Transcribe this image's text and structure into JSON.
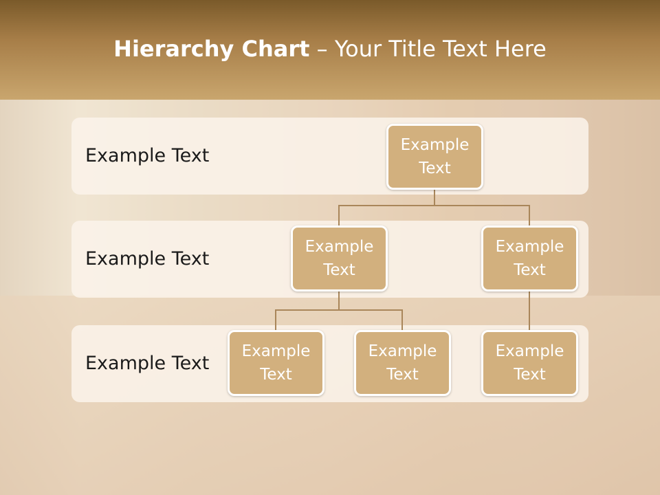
{
  "title": {
    "bold": "Hierarchy Chart",
    "rest": " – Your Title Text Here"
  },
  "levels": [
    {
      "label": "Example Text"
    },
    {
      "label": "Example Text"
    },
    {
      "label": "Example Text"
    }
  ],
  "nodes": {
    "root": "Example Text",
    "level2_left": "Example Text",
    "level2_right": "Example Text",
    "level3_a": "Example Text",
    "level3_b": "Example Text",
    "level3_c": "Example Text"
  },
  "colors": {
    "header": "#a77e48",
    "node": "#d2b07e",
    "connector": "#a9865a"
  }
}
